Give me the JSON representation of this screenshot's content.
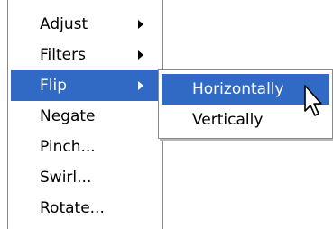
{
  "main_menu": {
    "items": [
      {
        "label": "Adjust",
        "has_submenu": true,
        "selected": false
      },
      {
        "label": "Filters",
        "has_submenu": true,
        "selected": false
      },
      {
        "label": "Flip",
        "has_submenu": true,
        "selected": true
      },
      {
        "label": "Negate",
        "has_submenu": false,
        "selected": false
      },
      {
        "label": "Pinch...",
        "has_submenu": false,
        "selected": false
      },
      {
        "label": "Swirl...",
        "has_submenu": false,
        "selected": false
      },
      {
        "label": "Rotate...",
        "has_submenu": false,
        "selected": false
      }
    ]
  },
  "flip_submenu": {
    "items": [
      {
        "label": "Horizontally",
        "selected": true
      },
      {
        "label": "Vertically",
        "selected": false
      }
    ]
  },
  "colors": {
    "highlight": "#316ac5",
    "highlight_text": "#ffffff",
    "menu_background": "#ffffff",
    "menu_border": "#8a8a8a"
  },
  "icons": {
    "submenu_arrow": "triangle-right-icon",
    "cursor": "arrow-cursor-icon"
  }
}
